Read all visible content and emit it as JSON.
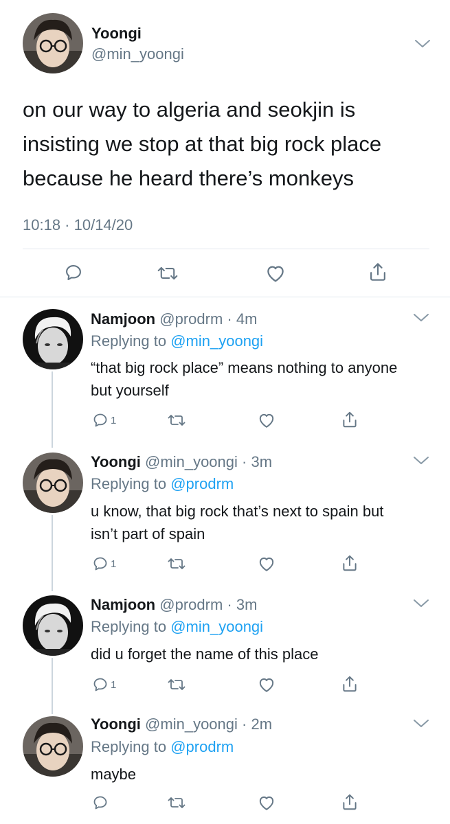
{
  "main_tweet": {
    "name": "Yoongi",
    "handle": "@min_yoongi",
    "text": "on our way to algeria and seokjin is insisting we stop at that big rock place because he heard there’s monkeys",
    "timestamp": "10:18 · 10/14/20"
  },
  "replies": [
    {
      "name": "Namjoon",
      "handle": "@prodrm",
      "time": "· 4m",
      "replying_label": "Replying to",
      "replying_to": "@min_yoongi",
      "text": "“that big rock place” means nothing to anyone but yourself",
      "reply_count": "1"
    },
    {
      "name": "Yoongi",
      "handle": "@min_yoongi",
      "time": "· 3m",
      "replying_label": "Replying to",
      "replying_to": "@prodrm",
      "text": "u know, that big rock that’s next to spain but isn’t part of spain",
      "reply_count": "1"
    },
    {
      "name": "Namjoon",
      "handle": "@prodrm",
      "time": "· 3m",
      "replying_label": "Replying to",
      "replying_to": "@min_yoongi",
      "text": "did u forget the name of this place",
      "reply_count": "1"
    },
    {
      "name": "Yoongi",
      "handle": "@min_yoongi",
      "time": "· 2m",
      "replying_label": "Replying to",
      "replying_to": "@prodrm",
      "text": "maybe",
      "reply_count": ""
    }
  ],
  "icons": {
    "reply": "speech-bubble-icon",
    "retweet": "retweet-icon",
    "like": "heart-icon",
    "share": "share-icon",
    "more": "chevron-down-icon"
  },
  "colors": {
    "text": "#14171a",
    "secondary": "#657786",
    "link": "#1da1f2",
    "divider": "#e1e8ed"
  }
}
